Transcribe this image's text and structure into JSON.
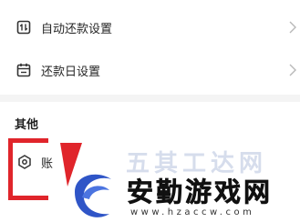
{
  "settings": {
    "rows": [
      {
        "label": "自动还款设置",
        "icon": "auto-repay-icon"
      },
      {
        "label": "还款日设置",
        "icon": "calendar-icon"
      }
    ]
  },
  "other": {
    "title": "其他",
    "account_label": "账",
    "account_icon": "hexagon-settings-icon"
  },
  "watermark": {
    "ghost_text": "五其工达网",
    "brand": "安勤游戏网",
    "domain": "www.hzaccw.com"
  },
  "colors": {
    "background": "#f4f4f4",
    "card": "#ffffff",
    "text": "#262626",
    "watermark_red": "#e0252b",
    "watermark_blue": "#2f55c7"
  }
}
